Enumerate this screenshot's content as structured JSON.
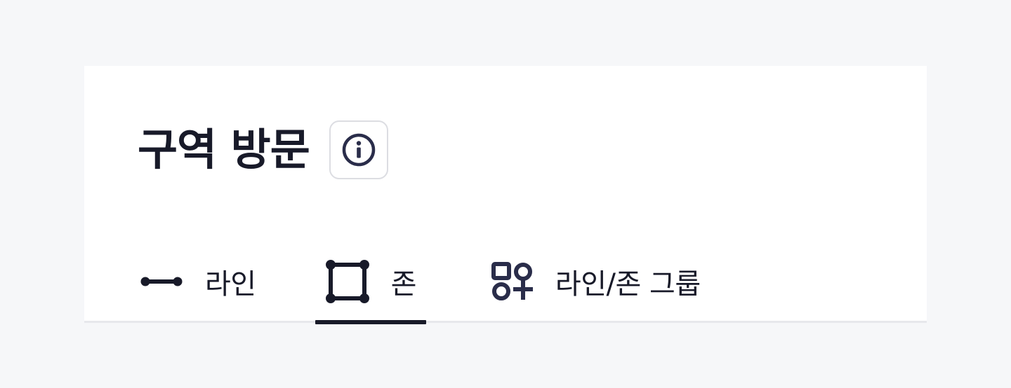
{
  "header": {
    "title": "구역 방문",
    "info_icon": "info-circle-icon"
  },
  "tabs": [
    {
      "label": "라인",
      "icon": "line-segment-icon",
      "active": false
    },
    {
      "label": "존",
      "icon": "zone-square-icon",
      "active": true
    },
    {
      "label": "라인/존 그룹",
      "icon": "line-zone-group-icon",
      "active": false
    }
  ],
  "colors": {
    "page_background": "#f6f7f9",
    "card_background": "#ffffff",
    "text": "#181a29",
    "icon_accent": "#2a2d4a",
    "divider": "#e7e8ec",
    "active_indicator": "#181a29"
  }
}
